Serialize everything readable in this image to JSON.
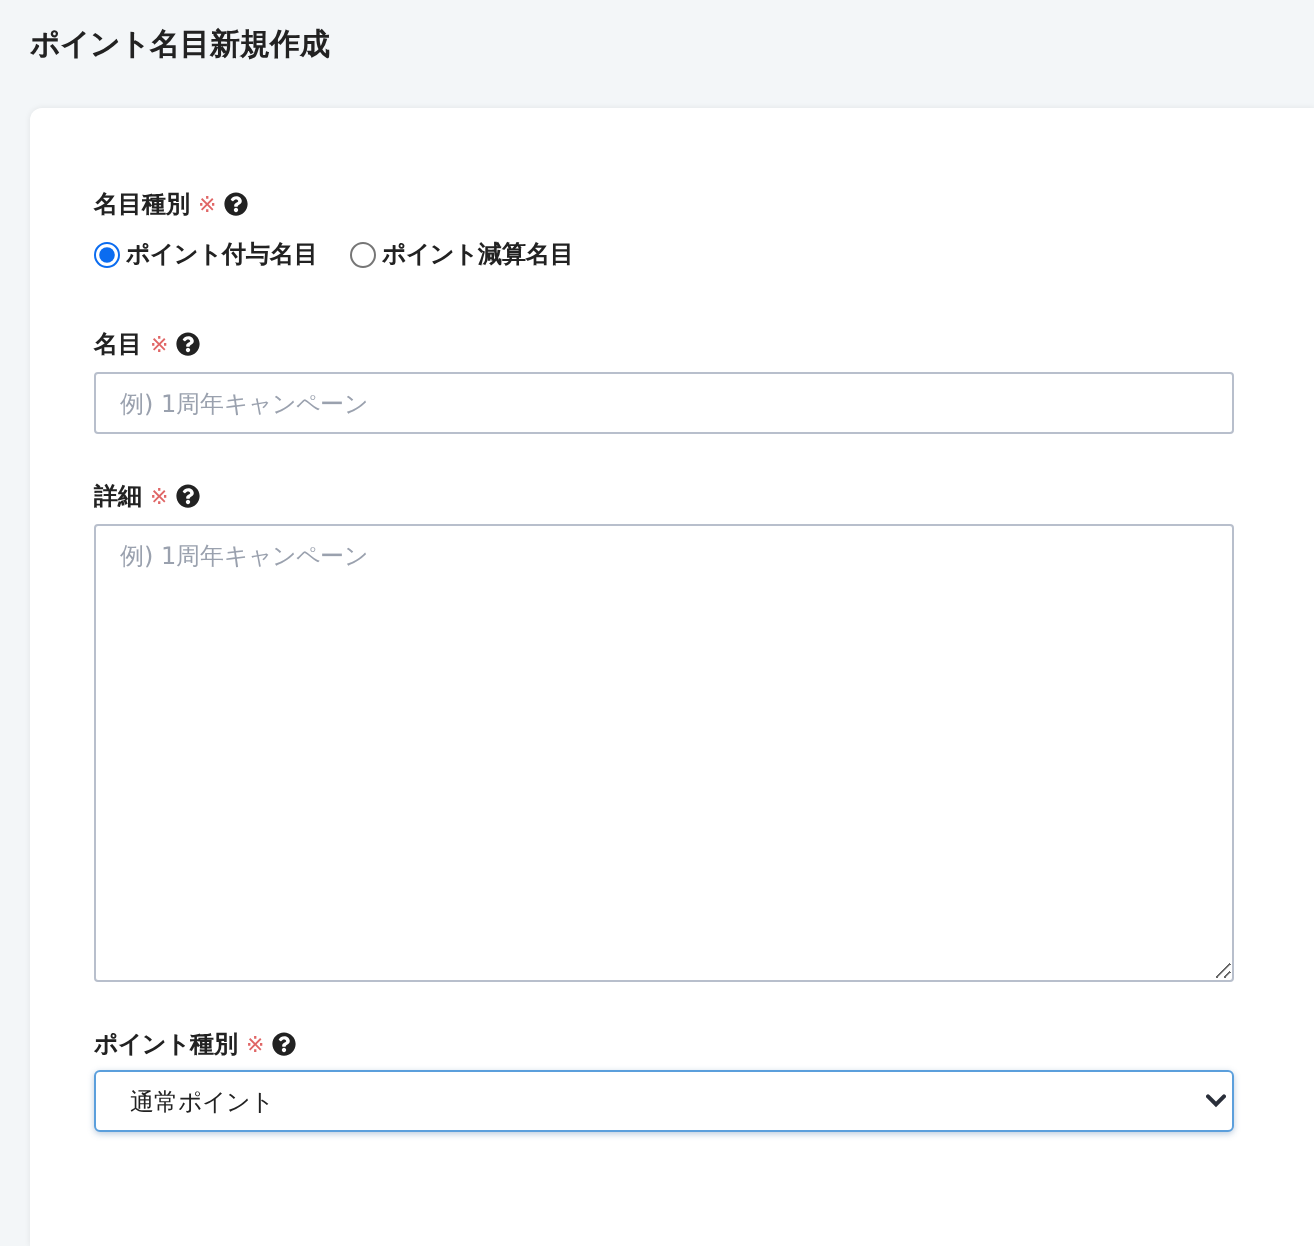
{
  "page": {
    "title": "ポイント名目新規作成"
  },
  "form": {
    "fields": [
      {
        "kind": "radio",
        "label": "名目種別",
        "required_mark": "※",
        "options": [
          {
            "label": "ポイント付与名目",
            "selected": true
          },
          {
            "label": "ポイント減算名目",
            "selected": false
          }
        ]
      },
      {
        "kind": "text",
        "label": "名目",
        "required_mark": "※",
        "placeholder": "例) 1周年キャンペーン"
      },
      {
        "kind": "textarea",
        "label": "詳細",
        "required_mark": "※",
        "placeholder": "例) 1周年キャンペーン"
      },
      {
        "kind": "select",
        "label": "ポイント種別",
        "required_mark": "※",
        "value": "通常ポイント",
        "focused": true
      }
    ]
  }
}
